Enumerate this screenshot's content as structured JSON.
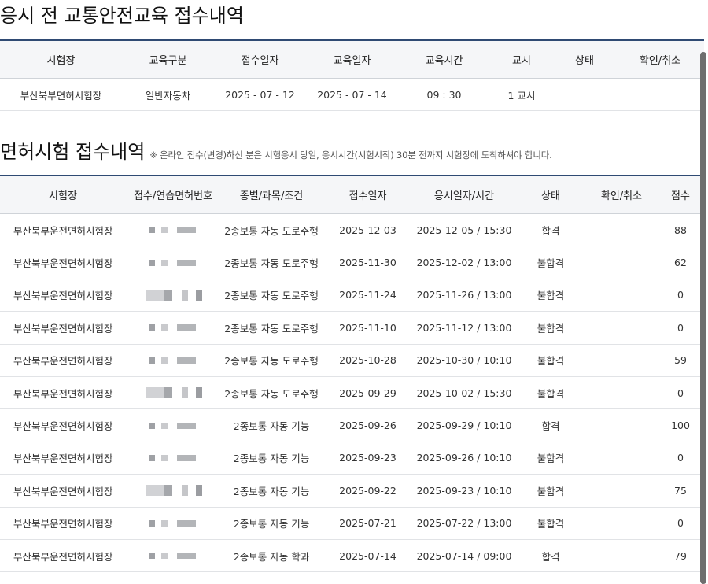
{
  "section1": {
    "title": "응시 전 교통안전교육 접수내역",
    "headers": [
      "시험장",
      "교육구분",
      "접수일자",
      "교육일자",
      "교육시간",
      "교시",
      "상태",
      "확인/취소"
    ],
    "rows": [
      [
        "부산북부면허시험장",
        "일반자동차",
        "2025 - 07 - 12",
        "2025 - 07 - 14",
        "09 : 30",
        "1 교시",
        "",
        ""
      ]
    ]
  },
  "section2": {
    "title": "면허시험 접수내역",
    "note": "※ 온라인 접수(변경)하신 분은 시험응시 당일, 응시시간(시험시작) 30분 전까지 시험장에 도착하셔야 합니다.",
    "headers": [
      "시험장",
      "접수/연습면허번호",
      "종별/과목/조건",
      "접수일자",
      "응시일자/시간",
      "상태",
      "확인/취소",
      "점수"
    ],
    "rows": [
      [
        "부산북부운전면허시험장",
        "",
        "2종보통 자동 도로주행",
        "2025-12-03",
        "2025-12-05 / 15:30",
        "합격",
        "",
        "88"
      ],
      [
        "부산북부운전면허시험장",
        "",
        "2종보통 자동 도로주행",
        "2025-11-30",
        "2025-12-02 / 13:00",
        "불합격",
        "",
        "62"
      ],
      [
        "부산북부운전면허시험장",
        "",
        "2종보통 자동 도로주행",
        "2025-11-24",
        "2025-11-26 / 13:00",
        "불합격",
        "",
        "0"
      ],
      [
        "부산북부운전면허시험장",
        "",
        "2종보통 자동 도로주행",
        "2025-11-10",
        "2025-11-12 / 13:00",
        "불합격",
        "",
        "0"
      ],
      [
        "부산북부운전면허시험장",
        "",
        "2종보통 자동 도로주행",
        "2025-10-28",
        "2025-10-30 / 10:10",
        "불합격",
        "",
        "59"
      ],
      [
        "부산북부운전면허시험장",
        "",
        "2종보통 자동 도로주행",
        "2025-09-29",
        "2025-10-02 / 15:30",
        "불합격",
        "",
        "0"
      ],
      [
        "부산북부운전면허시험장",
        "",
        "2종보통 자동 기능",
        "2025-09-26",
        "2025-09-29 / 10:10",
        "합격",
        "",
        "100"
      ],
      [
        "부산북부운전면허시험장",
        "",
        "2종보통 자동 기능",
        "2025-09-23",
        "2025-09-26 / 10:10",
        "불합격",
        "",
        "0"
      ],
      [
        "부산북부운전면허시험장",
        "",
        "2종보통 자동 기능",
        "2025-09-22",
        "2025-09-23 / 10:10",
        "불합격",
        "",
        "75"
      ],
      [
        "부산북부운전면허시험장",
        "",
        "2종보통 자동 기능",
        "2025-07-21",
        "2025-07-22 / 13:00",
        "불합격",
        "",
        "0"
      ],
      [
        "부산북부운전면허시험장",
        "",
        "2종보통 자동 학과",
        "2025-07-14",
        "2025-07-14 / 09:00",
        "합격",
        "",
        "79"
      ]
    ]
  },
  "colors": {
    "header_border": "#2f4a73",
    "header_bg": "#f5f6f8",
    "scrollbar": "#6e6e6e"
  }
}
